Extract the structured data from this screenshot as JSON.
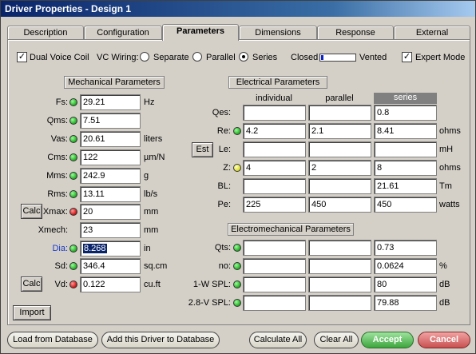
{
  "window": {
    "title": "Driver Properties - Design 1"
  },
  "tabs": [
    "Description",
    "Configuration",
    "Parameters",
    "Dimensions",
    "Response",
    "External"
  ],
  "active_tab": "Parameters",
  "options": {
    "dual_voice_coil": "Dual Voice Coil",
    "vc_wiring": "VC Wiring:",
    "separate": "Separate",
    "parallel": "Parallel",
    "series": "Series",
    "closed": "Closed",
    "vented": "Vented",
    "vent_level": 0.05,
    "expert_mode": "Expert Mode"
  },
  "mechanical": {
    "header": "Mechanical Parameters",
    "rows": [
      {
        "label": "Fs:",
        "value": "29.21",
        "unit": "Hz",
        "status": "green"
      },
      {
        "label": "Qms:",
        "value": "7.51",
        "unit": "",
        "status": "green"
      },
      {
        "label": "Vas:",
        "value": "20.61",
        "unit": "liters",
        "status": "green"
      },
      {
        "label": "Cms:",
        "value": "122",
        "unit": "µm/N",
        "status": "green"
      },
      {
        "label": "Mms:",
        "value": "242.9",
        "unit": "g",
        "status": "green"
      },
      {
        "label": "Rms:",
        "value": "13.11",
        "unit": "lb/s",
        "status": "green"
      },
      {
        "label": "Xmax:",
        "value": "20",
        "unit": "mm",
        "status": "red"
      },
      {
        "label": "Xmech:",
        "value": "23",
        "unit": "mm",
        "status": "none"
      },
      {
        "label": "Dia:",
        "value": "8.268",
        "unit": "in",
        "status": "green"
      },
      {
        "label": "Sd:",
        "value": "346.4",
        "unit": "sq.cm",
        "status": "green"
      },
      {
        "label": "Vd:",
        "value": "0.122",
        "unit": "cu.ft",
        "status": "red"
      }
    ],
    "calc_label": "Calc",
    "import_label": "Import"
  },
  "electrical": {
    "header": "Electrical Parameters",
    "columns": [
      "individual",
      "parallel",
      "series"
    ],
    "est_label": "Est",
    "rows": [
      {
        "label": "Qes:",
        "values": [
          "",
          "",
          "0.8"
        ],
        "unit": "",
        "status": "none"
      },
      {
        "label": "Re:",
        "values": [
          "4.2",
          "2.1",
          "8.41"
        ],
        "unit": "ohms",
        "status": "green"
      },
      {
        "label": "Le:",
        "values": [
          "",
          "",
          ""
        ],
        "unit": "mH",
        "status": "none"
      },
      {
        "label": "Z:",
        "values": [
          "4",
          "2",
          "8"
        ],
        "unit": "ohms",
        "status": "yellow"
      },
      {
        "label": "BL:",
        "values": [
          "",
          "",
          "21.61"
        ],
        "unit": "Tm",
        "status": "none"
      },
      {
        "label": "Pe:",
        "values": [
          "225",
          "450",
          "450"
        ],
        "unit": "watts",
        "status": "none"
      }
    ]
  },
  "electromechanical": {
    "header": "Electromechanical Parameters",
    "rows": [
      {
        "label": "Qts:",
        "values": [
          "",
          "",
          "0.73"
        ],
        "unit": "",
        "status": "green"
      },
      {
        "label": "no:",
        "values": [
          "",
          "",
          "0.0624"
        ],
        "unit": "%",
        "status": "green"
      },
      {
        "label": "1-W SPL:",
        "values": [
          "",
          "",
          "80"
        ],
        "unit": "dB",
        "status": "green"
      },
      {
        "label": "2.8-V SPL:",
        "values": [
          "",
          "",
          "79.88"
        ],
        "unit": "dB",
        "status": "green"
      }
    ]
  },
  "footer": {
    "load": "Load from Database",
    "add": "Add this Driver to Database",
    "calculate_all": "Calculate All",
    "clear_all": "Clear All",
    "accept": "Accept",
    "cancel": "Cancel"
  }
}
